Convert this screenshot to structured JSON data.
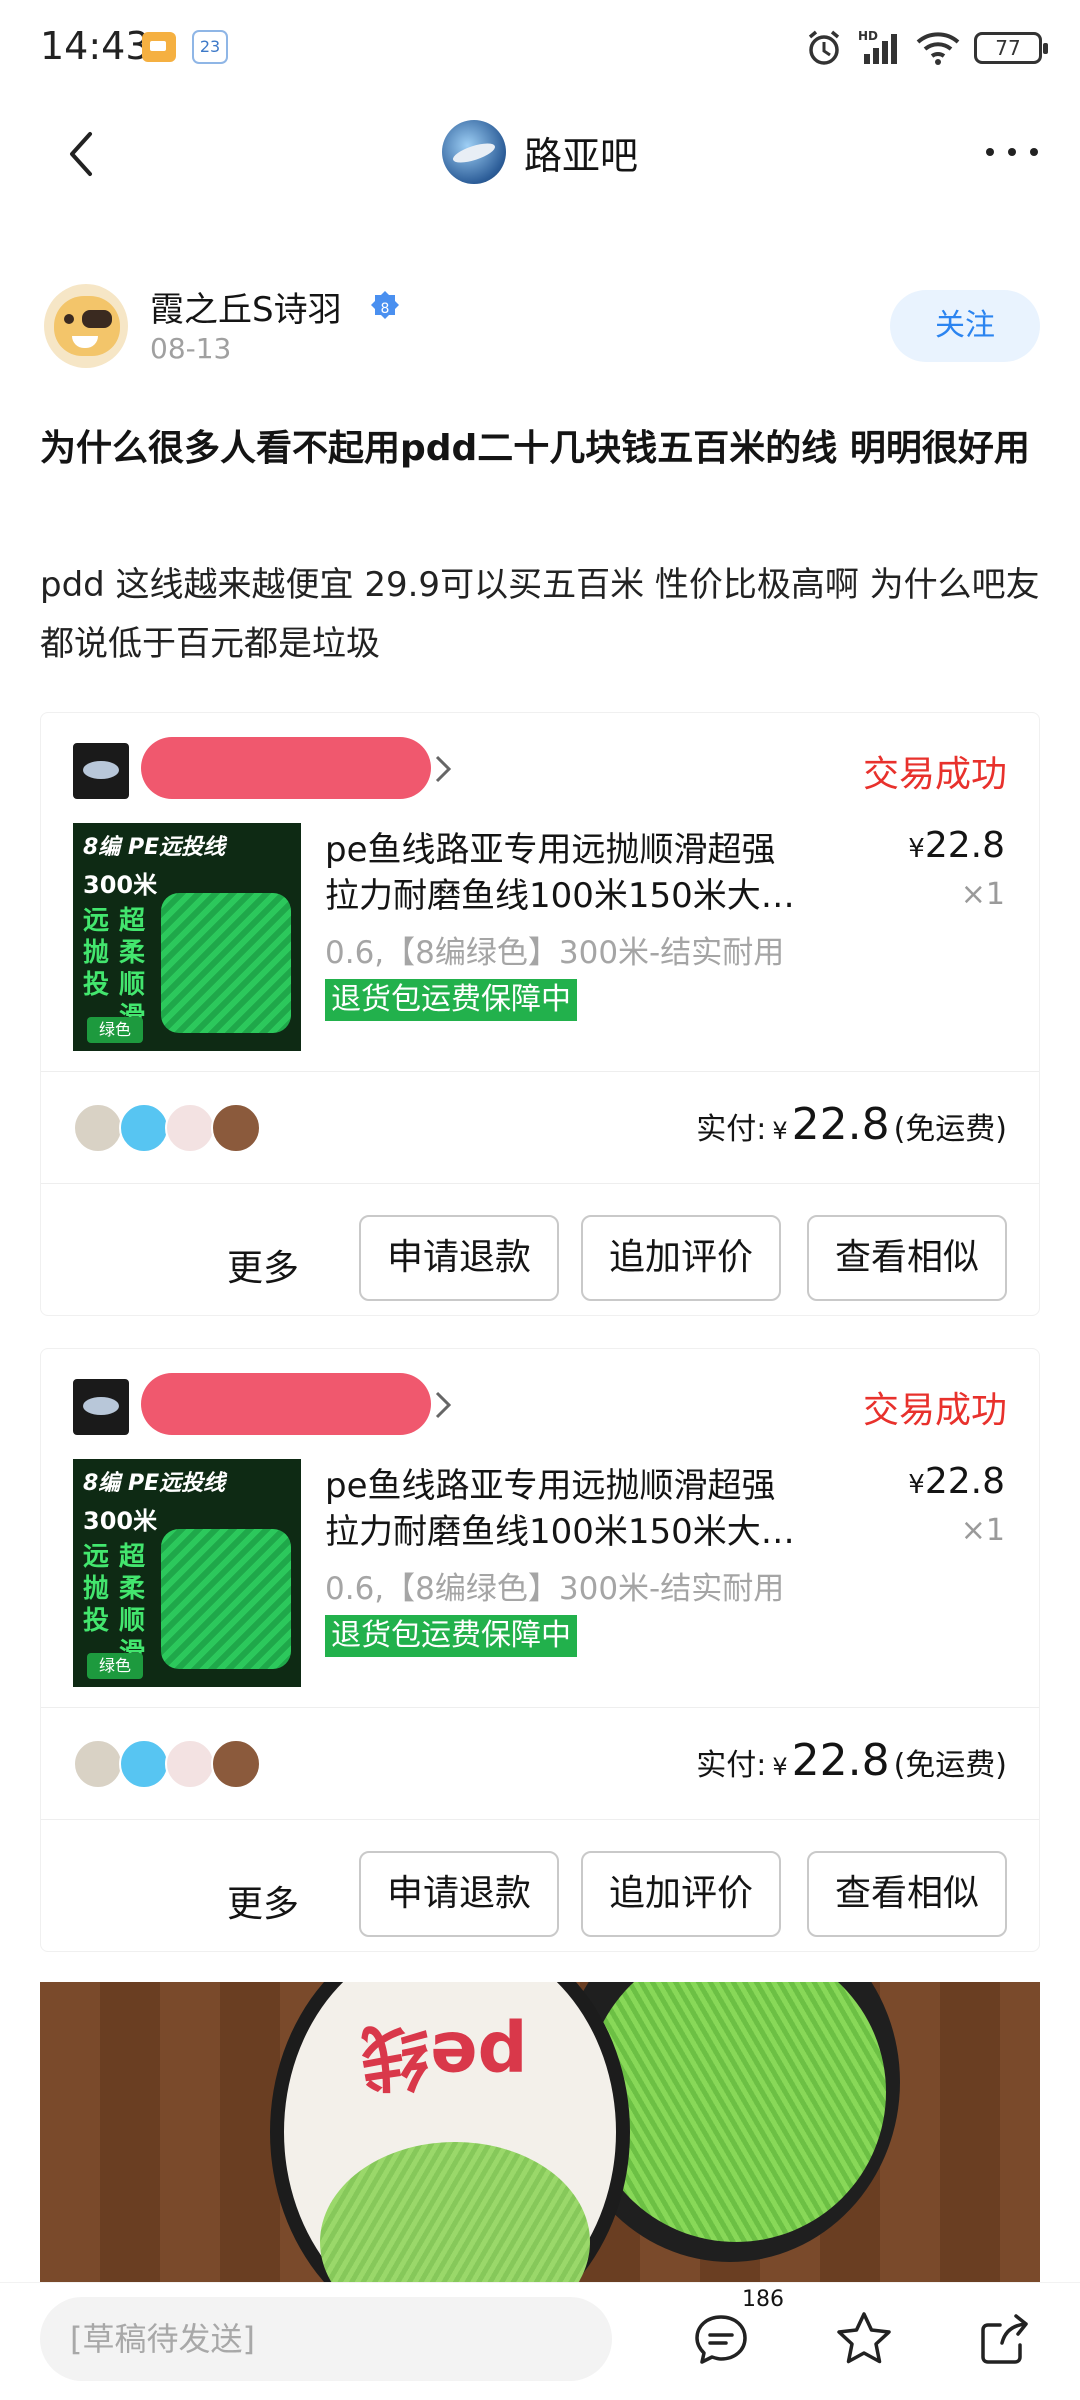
{
  "status_bar": {
    "time": "14:43",
    "notif_badge": "23",
    "battery": "77"
  },
  "header": {
    "forum_title": "路亚吧"
  },
  "post": {
    "author_name": "霞之丘S诗羽",
    "author_level": "8",
    "date": "08-13",
    "follow_label": "关注",
    "title": "为什么很多人看不起用pdd二十几块钱五百米的线  明明很好用",
    "body": "pdd 这线越来越便宜 29.9可以买五百米 性价比极高啊 为什么吧友都说低于百元都是垃圾"
  },
  "orders": [
    {
      "status": "交易成功",
      "product_image_tag": "8编 PE远投线",
      "product_image_length": "300米",
      "product_image_col1": "远抛投",
      "product_image_col2": "超柔顺滑",
      "product_image_chip": "绿色",
      "product_title_line1": "pe鱼线路亚专用远抛顺滑超强",
      "product_title_line2": "拉力耐磨鱼线100米150米大…",
      "price_currency": "¥",
      "price": "22.8",
      "quantity": "×1",
      "spec": "0.6,【8编绿色】300米-结实耐用",
      "guarantee": "退货包运费保障中",
      "paid_label": "实付:",
      "paid_currency": "¥",
      "paid_amount": "22.8",
      "shipping_note": "(免运费)",
      "more_label": "更多",
      "btn_refund": "申请退款",
      "btn_review": "追加评价",
      "btn_similar": "查看相似"
    },
    {
      "status": "交易成功",
      "product_image_tag": "8编 PE远投线",
      "product_image_length": "300米",
      "product_image_col1": "远抛投",
      "product_image_col2": "超柔顺滑",
      "product_image_chip": "绿色",
      "product_title_line1": "pe鱼线路亚专用远抛顺滑超强",
      "product_title_line2": "拉力耐磨鱼线100米150米大…",
      "price_currency": "¥",
      "price": "22.8",
      "quantity": "×1",
      "spec": "0.6,【8编绿色】300米-结实耐用",
      "guarantee": "退货包运费保障中",
      "paid_label": "实付:",
      "paid_currency": "¥",
      "paid_amount": "22.8",
      "shipping_note": "(免运费)",
      "more_label": "更多",
      "btn_refund": "申请退款",
      "btn_review": "追加评价",
      "btn_similar": "查看相似"
    }
  ],
  "photo": {
    "spool_text": "pe线"
  },
  "bottom_bar": {
    "draft_placeholder": "[草稿待发送]",
    "comment_count": "186"
  },
  "colors": {
    "accent_blue": "#2b84f0",
    "status_red": "#e8312c",
    "guarantee_green": "#22b14c"
  }
}
